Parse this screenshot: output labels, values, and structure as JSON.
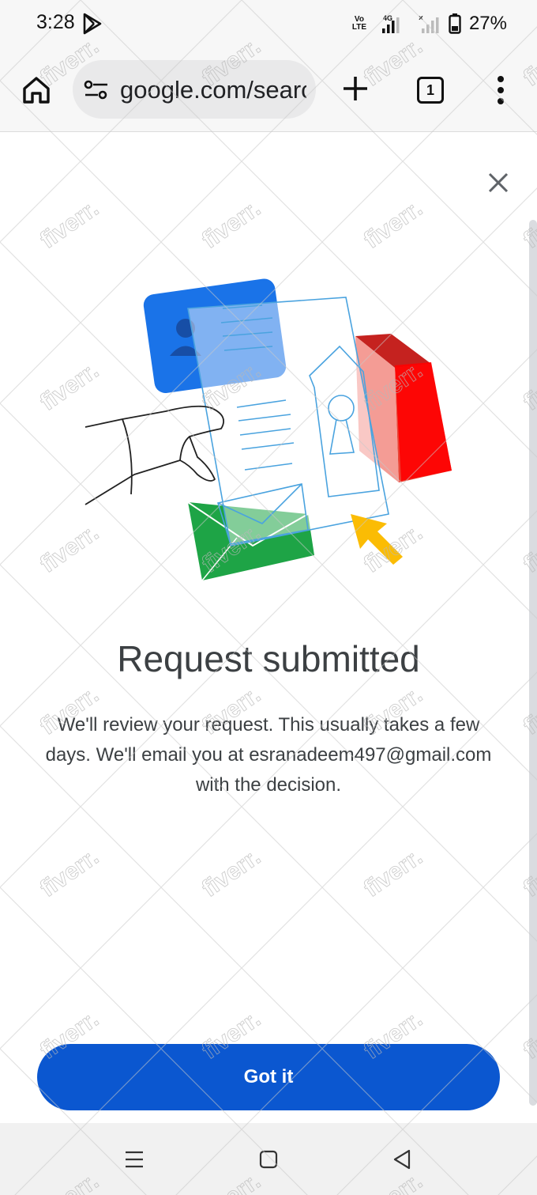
{
  "status_bar": {
    "time": "3:28",
    "volte": "Vo\nLTE",
    "network": "4G",
    "battery_percent": "27%",
    "icons": [
      "play-store-icon",
      "volte-icon",
      "signal-icon",
      "battery-icon"
    ]
  },
  "browser": {
    "url": "google.com/search",
    "tab_count": "1",
    "icons": [
      "home-icon",
      "tune-icon",
      "new-tab-icon",
      "tabs-icon",
      "more-menu-icon"
    ]
  },
  "dialog": {
    "title": "Request submitted",
    "description": "We'll review your request. This usually takes a few days. We'll email you at esranadeem497@gmail.com with the decision.",
    "button_label": "Got it",
    "accent_color": "#0b57d0"
  },
  "watermark": {
    "text": "fiverr."
  },
  "nav_bar": {
    "icons": [
      "recent-apps-icon",
      "home-nav-icon",
      "back-icon"
    ]
  }
}
